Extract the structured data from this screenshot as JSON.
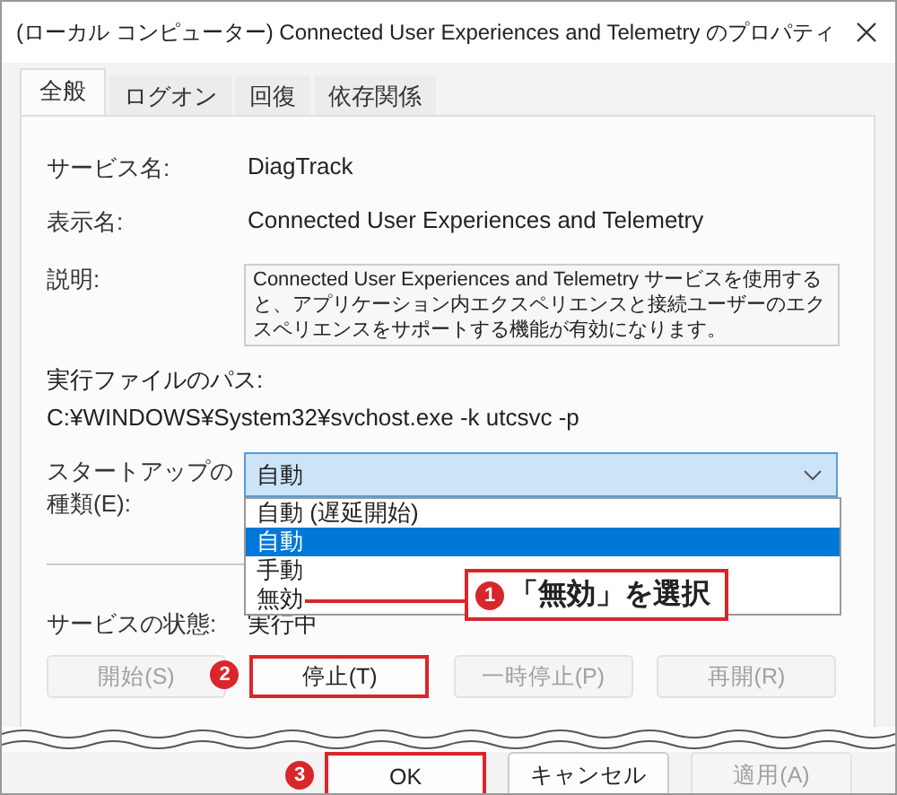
{
  "window": {
    "title": "(ローカル コンピューター) Connected User Experiences and Telemetry のプロパティ"
  },
  "tabs": [
    {
      "label": "全般",
      "selected": true
    },
    {
      "label": "ログオン",
      "selected": false
    },
    {
      "label": "回復",
      "selected": false
    },
    {
      "label": "依存関係",
      "selected": false
    }
  ],
  "service_name": {
    "label": "サービス名:",
    "value": "DiagTrack"
  },
  "display_name": {
    "label": "表示名:",
    "value": "Connected User Experiences and Telemetry"
  },
  "description": {
    "label": "説明:",
    "value": "Connected User Experiences and Telemetry サービスを使用すると、アプリケーション内エクスペリエンスと接続ユーザーのエクスペリエンスをサポートする機能が有効になります。"
  },
  "executable_path": {
    "label": "実行ファイルのパス:",
    "value": "C:¥WINDOWS¥System32¥svchost.exe -k utcsvc -p"
  },
  "startup_type": {
    "label": "スタートアップの種類(E):",
    "value": "自動",
    "expanded": true,
    "options": [
      {
        "label": "自動 (遅延開始)",
        "selected": false
      },
      {
        "label": "自動",
        "selected": true
      },
      {
        "label": "手動",
        "selected": false
      },
      {
        "label": "無効",
        "selected": false
      }
    ]
  },
  "callout": {
    "step": "1",
    "text": "「無効」を選択"
  },
  "service_status": {
    "label": "サービスの状態:",
    "value": "実行中"
  },
  "service_buttons": [
    {
      "label": "開始(S)",
      "disabled": true,
      "highlighted": false
    },
    {
      "label": "停止(T)",
      "disabled": false,
      "highlighted": true,
      "step": "2"
    },
    {
      "label": "一時停止(P)",
      "disabled": true,
      "highlighted": false
    },
    {
      "label": "再開(R)",
      "disabled": true,
      "highlighted": false
    }
  ],
  "dialog_buttons": [
    {
      "label": "OK",
      "disabled": false,
      "highlighted": true,
      "step": "3"
    },
    {
      "label": "キャンセル",
      "disabled": false,
      "highlighted": false
    },
    {
      "label": "適用(A)",
      "disabled": true,
      "highlighted": false
    }
  ]
}
